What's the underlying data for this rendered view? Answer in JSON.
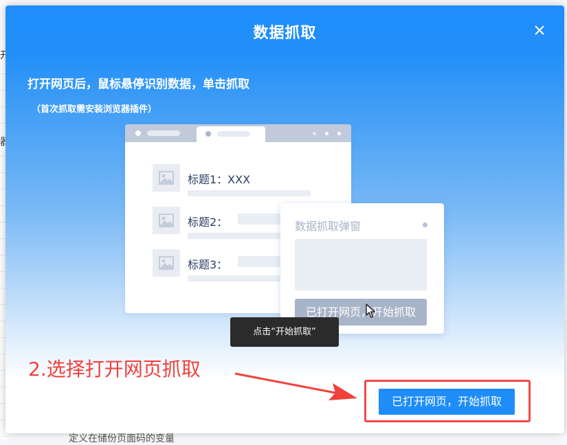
{
  "background": {
    "fragment_1": "开",
    "fragment_2": "器",
    "bottom_text": "定义在储份页面码的变量"
  },
  "modal": {
    "title": "数据抓取",
    "close_icon": "close-icon",
    "headline": "打开网页后，鼠标悬停识别数据，单击抓取",
    "subline": "（首次抓取需安装浏览器插件）"
  },
  "illustration": {
    "rows": [
      {
        "title": "标题1：XXX"
      },
      {
        "title": "标题2："
      },
      {
        "title": "标题3："
      }
    ],
    "popup": {
      "title": "数据抓取弹窗",
      "button": "已打开网页，开始抓取"
    },
    "tooltip": "点击“开始抓取”"
  },
  "annotation": {
    "step_label": "2.选择打开网页抓取"
  },
  "footer": {
    "start_button": "已打开网页，开始抓取"
  },
  "colors": {
    "primary": "#1e8df8",
    "annotation_red": "#f0413c"
  }
}
